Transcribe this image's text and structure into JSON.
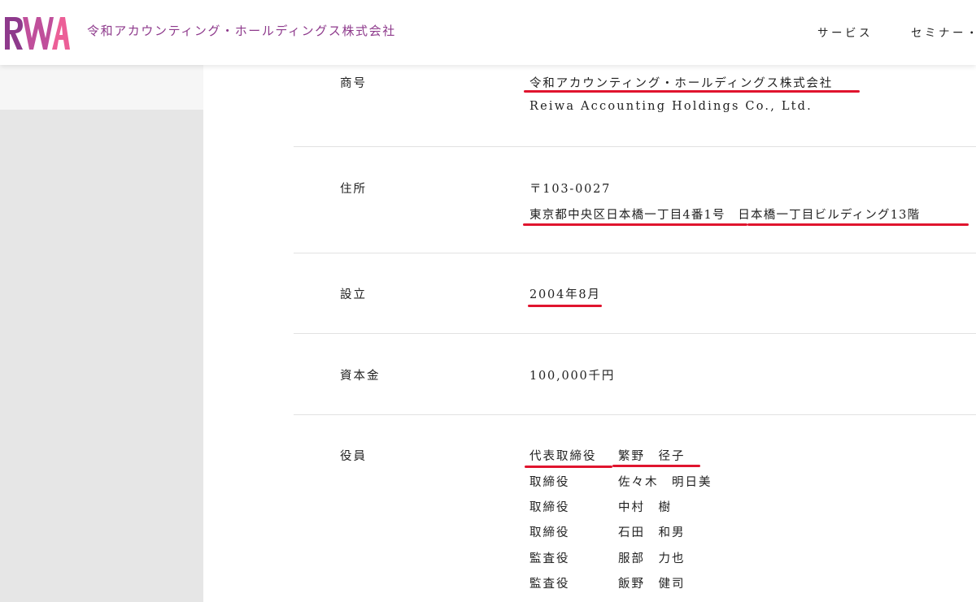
{
  "header": {
    "logo_text": "RWA",
    "company_name": "令和アカウンティング・ホールディングス株式会社",
    "nav": [
      "サービス",
      "セミナー・"
    ]
  },
  "colors": {
    "brand_purple": "#8e3a8c",
    "logo_pink": "#ec5f97",
    "underline_red": "#e0142e"
  },
  "company_info": {
    "trade_name": {
      "label": "商号",
      "value_ja": "令和アカウンティング・ホールディングス株式会社",
      "value_en": "Reiwa Accounting Holdings Co., Ltd."
    },
    "address": {
      "label": "住所",
      "postal": "〒103-0027",
      "line": "東京都中央区日本橋一丁目4番1号　日本橋一丁目ビルディング13階"
    },
    "established": {
      "label": "設立",
      "value": "2004年8月"
    },
    "capital": {
      "label": "資本金",
      "value": "100,000千円"
    },
    "officers": {
      "label": "役員",
      "list": [
        {
          "role": "代表取締役",
          "name": "繁野　径子"
        },
        {
          "role": "取締役",
          "name": "佐々木　明日美"
        },
        {
          "role": "取締役",
          "name": "中村　樹"
        },
        {
          "role": "取締役",
          "name": "石田　和男"
        },
        {
          "role": "監査役",
          "name": "服部　力也"
        },
        {
          "role": "監査役",
          "name": "飯野　健司"
        }
      ]
    }
  }
}
